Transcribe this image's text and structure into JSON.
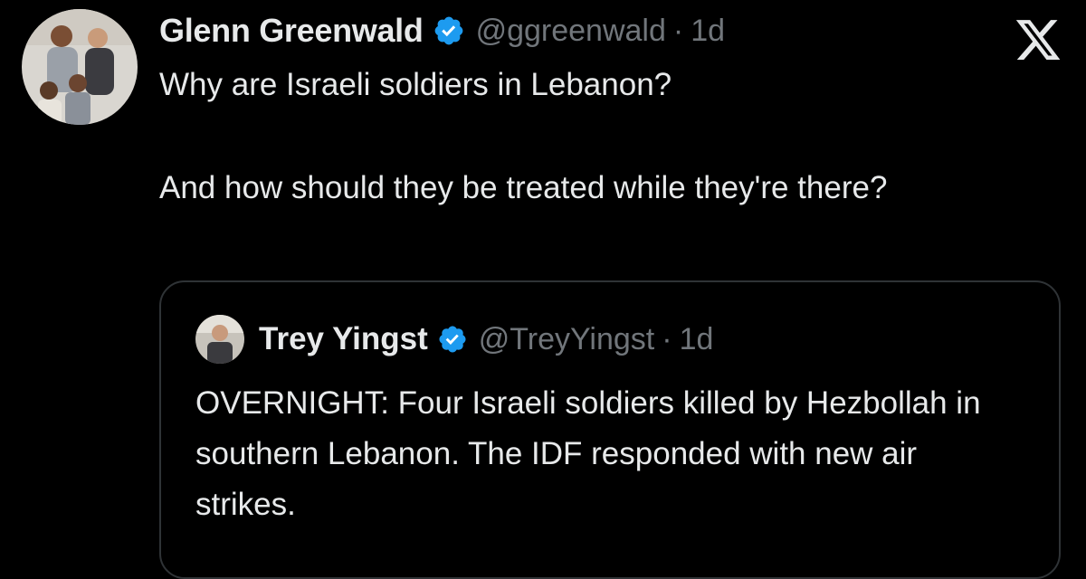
{
  "tweet": {
    "author_name": "Glenn Greenwald",
    "handle": "@ggreenwald",
    "separator": "·",
    "time": "1d",
    "paragraphs": [
      "Why are Israeli soldiers in Lebanon?",
      "And how should they be treated while they're there?"
    ]
  },
  "quoted_tweet": {
    "author_name": "Trey Yingst",
    "handle": "@TreyYingst",
    "separator": "·",
    "time": "1d",
    "text": "OVERNIGHT: Four Israeli soldiers killed by Hezbollah in southern Lebanon. The IDF responded with new air strikes."
  },
  "icons": {
    "verified": "verified-badge-icon",
    "platform": "x-logo-icon"
  },
  "colors": {
    "background": "#000000",
    "text_primary": "#e7e9ea",
    "text_secondary": "#71767b",
    "verified_blue": "#1d9bf0",
    "card_border": "#2f3336"
  }
}
